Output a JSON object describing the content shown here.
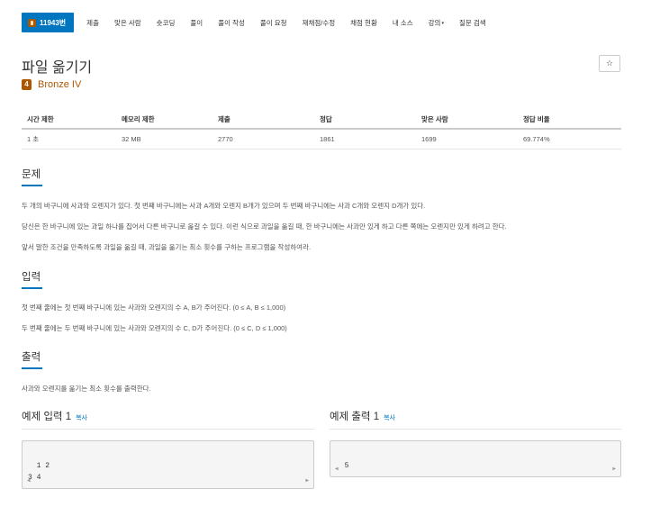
{
  "nav": {
    "active_label": "11943번",
    "items": [
      "제출",
      "맞은 사람",
      "숏코딩",
      "풀이",
      "풀이 작성",
      "풀이 요청",
      "재채점/수정",
      "채점 현황",
      "내 소스",
      "강의",
      "질문 검색"
    ],
    "dropdown_caret": "▾"
  },
  "problem": {
    "title": "파일 옮기기",
    "star": "☆",
    "tier_number": "4",
    "tier_label": "Bronze IV",
    "tier_color": "#ad5600"
  },
  "info_table": {
    "headers": [
      "시간 제한",
      "메모리 제한",
      "제출",
      "정답",
      "맞은 사람",
      "정답 비율"
    ],
    "row": [
      "1 초",
      "32 MB",
      "2770",
      "1861",
      "1699",
      "69.774%"
    ]
  },
  "sections": {
    "problem_title": "문제",
    "problem_lines": [
      "두 개의 바구니에 사과와 오렌지가 있다. 첫 번째 바구니에는 사과 A개와 오렌지 B개가 있으며 두 번째 바구니에는 사과 C개와 오렌지 D개가 있다.",
      "당신은 한 바구니에 있는 과일 하나를 집어서 다른 바구니로 옮길 수 있다. 이런 식으로 과일을 옮길 때, 한 바구니에는 사과만 있게 하고 다른 쪽에는 오렌지만 있게 하려고 한다.",
      "앞서 말한 조건을 만족하도록 과일을 옮길 때, 과일을 옮기는 최소 횟수를 구하는 프로그램을 작성하여라."
    ],
    "input_title": "입력",
    "input_lines": [
      "첫 번째 줄에는 첫 번째 바구니에 있는 사과와 오렌지의 수 A, B가 주어진다. (0 ≤ A, B ≤ 1,000)",
      "두 번째 줄에는 두 번째 바구니에 있는 사과와 오렌지의 수 C, D가 주어진다. (0 ≤ C, D ≤ 1,000)"
    ],
    "output_title": "출력",
    "output_lines": [
      "사과와 오렌지를 옮기는 최소 횟수를 출력한다."
    ]
  },
  "samples": {
    "input_title": "예제 입력 1",
    "output_title": "예제 출력 1",
    "copy_label": "복사",
    "input_text": "1 2\n3 4",
    "output_text": "5",
    "scroll_left": "◀",
    "scroll_right": "▶"
  },
  "colors": {
    "accent": "#0076c0",
    "tier": "#ad5600"
  }
}
